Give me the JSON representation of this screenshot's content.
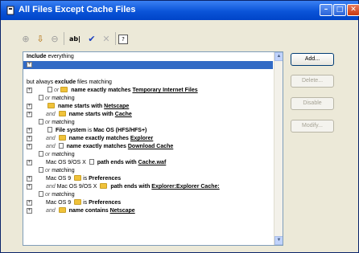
{
  "window": {
    "title": "All Files Except Cache Files"
  },
  "titlebar_buttons": {
    "minimize": "–",
    "maximize": "□",
    "close": "✕"
  },
  "toolbar": {
    "items": [
      {
        "icon": "expand-rule-icon",
        "glyph": "⊕"
      },
      {
        "icon": "move-rule-icon",
        "glyph": "⇩"
      },
      {
        "icon": "collapse-rule-icon",
        "glyph": "⊖"
      },
      {
        "icon": "rename-icon",
        "glyph": "ab|"
      },
      {
        "icon": "check-icon",
        "glyph": "✔"
      },
      {
        "icon": "delete-x-icon",
        "glyph": "✕"
      },
      {
        "icon": "help-icon",
        "glyph": "?"
      }
    ]
  },
  "rules": {
    "include_label": "Include",
    "include_rest": " everything",
    "exclude_prefix": "but always ",
    "exclude_label": "exclude",
    "exclude_rest": " files matching",
    "rows": [
      {
        "op": "",
        "or": "or",
        "kind": "name exactly matches",
        "value": "Temporary Internet Files"
      },
      {
        "or": "or",
        "word": "matching"
      },
      {
        "kind": "name starts with",
        "value": "Netscape"
      },
      {
        "op": "and",
        "kind": "name starts with",
        "value": "Cache"
      },
      {
        "or": "or",
        "word": "matching"
      },
      {
        "kind": "File system",
        "is": "is",
        "value": "Mac OS (HFS/HFS+)"
      },
      {
        "op": "and",
        "kind": "name exactly matches",
        "value": "Explorer"
      },
      {
        "op": "and",
        "kind": "name exactly matches",
        "value": "Download Cache"
      },
      {
        "or": "or",
        "word": "matching"
      },
      {
        "mac": "Mac OS 9/OS X",
        "kind": "path ends with",
        "value": "Cache.waf"
      },
      {
        "or": "or",
        "word": "matching"
      },
      {
        "mac": "Mac OS 9",
        "is": "is",
        "value": "Preferences"
      },
      {
        "op": "and",
        "mac": "Mac OS 9/OS X",
        "kind": "path ends with",
        "value": "Explorer:Explorer Cache:"
      },
      {
        "or": "or",
        "word": "matching"
      },
      {
        "mac": "Mac OS 9",
        "is": "is",
        "value": "Preferences"
      },
      {
        "op": "and",
        "kind": "name contains",
        "value": "Netscape"
      }
    ]
  },
  "buttons": {
    "add": "Add...",
    "delete": "Delete...",
    "disable": "Disable",
    "modify": "Modify..."
  }
}
